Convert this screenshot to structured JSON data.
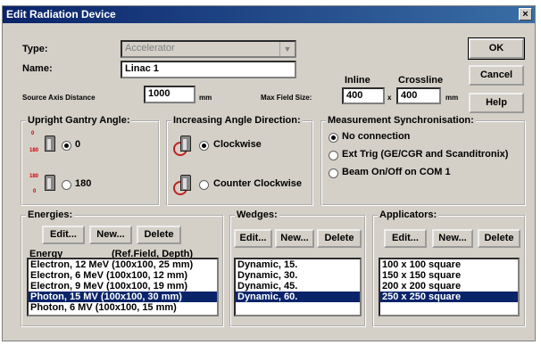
{
  "window": {
    "title": "Edit Radiation Device",
    "close_glyph": "×"
  },
  "type": {
    "label": "Type:",
    "value": "Accelerator"
  },
  "name": {
    "label": "Name:",
    "value": "Linac 1"
  },
  "sad": {
    "label": "Source Axis Distance",
    "value": "1000",
    "unit": "mm"
  },
  "field": {
    "label": "Max Field Size:",
    "inline_label": "Inline",
    "crossline_label": "Crossline",
    "inline_value": "400",
    "crossline_value": "400",
    "times": "x",
    "unit": "mm"
  },
  "buttons": {
    "ok": "OK",
    "cancel": "Cancel",
    "help": "Help"
  },
  "gantry": {
    "title": "Upright Gantry Angle:",
    "opt0": {
      "label": "0",
      "marks": [
        "0",
        "180"
      ]
    },
    "opt180": {
      "label": "180",
      "marks": [
        "180",
        "0"
      ]
    },
    "selected": "0"
  },
  "direction": {
    "title": "Increasing Angle Direction:",
    "opt1": "Clockwise",
    "opt2": "Counter Clockwise",
    "selected": "Clockwise"
  },
  "sync": {
    "title": "Measurement Synchronisation:",
    "opt1": "No connection",
    "opt2": "Ext Trig (GE/CGR and Scanditronix)",
    "opt3": "Beam On/Off on COM 1",
    "selected": "No connection"
  },
  "energies": {
    "title": "Energies:",
    "edit": "Edit...",
    "new": "New...",
    "delete": "Delete",
    "col1": "Energy",
    "col2": "(Ref.Field, Depth)",
    "items": [
      "Electron, 12 MeV  (100x100, 25 mm)",
      "Electron, 6 MeV  (100x100, 12 mm)",
      "Electron, 9 MeV  (100x100, 19 mm)",
      "Photon, 15 MV  (100x100, 30 mm)",
      "Photon, 6 MV  (100x100, 15 mm)"
    ],
    "selected_index": 3
  },
  "wedges": {
    "title": "Wedges:",
    "edit": "Edit...",
    "new": "New...",
    "delete": "Delete",
    "items": [
      "Dynamic, 15.",
      "Dynamic, 30.",
      "Dynamic, 45.",
      "Dynamic, 60."
    ],
    "selected_index": 3
  },
  "applicators": {
    "title": "Applicators:",
    "edit": "Edit...",
    "new": "New...",
    "delete": "Delete",
    "items": [
      "100 x 100 square",
      "150 x 150 square",
      "200 x 200 square",
      "250 x 250 square"
    ],
    "selected_index": 3
  },
  "colors": {
    "selection": "#0a246a",
    "face": "#d4d0c8",
    "title_start": "#0a246a",
    "title_end": "#3a6ea5"
  }
}
